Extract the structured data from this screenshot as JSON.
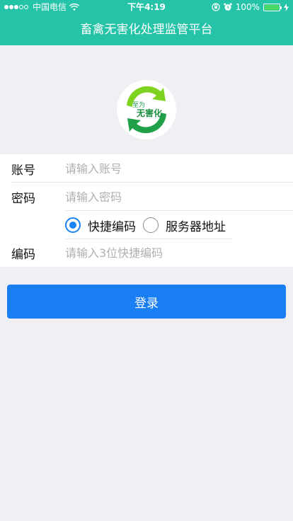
{
  "status_bar": {
    "carrier": "中国电信",
    "time": "下午4:19",
    "battery_text": "100%",
    "battery_level": 1.0
  },
  "header": {
    "title": "畜禽无害化处理监管平台"
  },
  "logo": {
    "line1": "至为",
    "line2": "无害化",
    "colors": {
      "arrow_light": "#7ed321",
      "arrow_dark": "#1fa049"
    }
  },
  "form": {
    "account_label": "账号",
    "account_placeholder": "请输入账号",
    "password_label": "密码",
    "password_placeholder": "请输入密码",
    "options": [
      {
        "label": "快捷编码",
        "checked": true
      },
      {
        "label": "服务器地址",
        "checked": false
      }
    ],
    "code_label": "编码",
    "code_placeholder": "请输入3位快捷编码"
  },
  "login_button": {
    "label": "登录"
  },
  "colors": {
    "header_bg": "#25c3a8",
    "button_bg": "#1a7ff5",
    "radio_accent": "#1a82f7",
    "page_bg": "#efeff4"
  }
}
